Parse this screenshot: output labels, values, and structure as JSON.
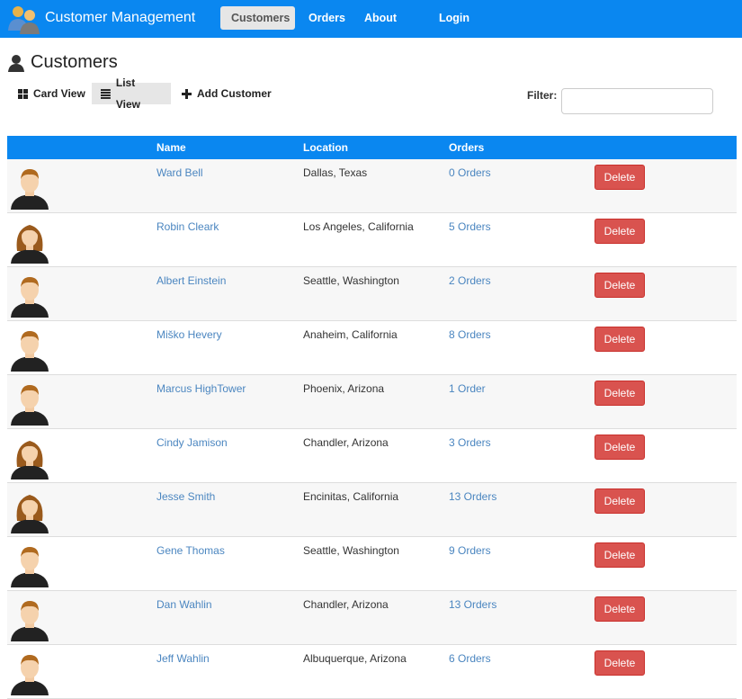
{
  "app": {
    "title": "Customer Management"
  },
  "nav": {
    "items": [
      {
        "label": "Customers",
        "active": true
      },
      {
        "label": "Orders"
      },
      {
        "label": "About"
      },
      {
        "label": "Login"
      }
    ]
  },
  "page": {
    "title": "Customers"
  },
  "toolbar": {
    "card_view": "Card View",
    "list_view": "List View",
    "add_customer": "Add Customer",
    "filter_label": "Filter:",
    "filter_value": ""
  },
  "table": {
    "headers": {
      "name": "Name",
      "location": "Location",
      "orders": "Orders"
    },
    "delete_label": "Delete",
    "rows": [
      {
        "name": "Ward Bell",
        "location": "Dallas, Texas",
        "orders": "0 Orders",
        "gender": "male"
      },
      {
        "name": "Robin Cleark",
        "location": "Los Angeles, California",
        "orders": "5 Orders",
        "gender": "female"
      },
      {
        "name": "Albert Einstein",
        "location": "Seattle, Washington",
        "orders": "2 Orders",
        "gender": "male"
      },
      {
        "name": "Miško Hevery",
        "location": "Anaheim, California",
        "orders": "8 Orders",
        "gender": "male"
      },
      {
        "name": "Marcus HighTower",
        "location": "Phoenix, Arizona",
        "orders": "1 Order",
        "gender": "male"
      },
      {
        "name": "Cindy Jamison",
        "location": "Chandler, Arizona",
        "orders": "3 Orders",
        "gender": "female"
      },
      {
        "name": "Jesse Smith",
        "location": "Encinitas, California",
        "orders": "13 Orders",
        "gender": "female"
      },
      {
        "name": "Gene Thomas",
        "location": "Seattle, Washington",
        "orders": "9 Orders",
        "gender": "male"
      },
      {
        "name": "Dan Wahlin",
        "location": "Chandler, Arizona",
        "orders": "13 Orders",
        "gender": "male"
      },
      {
        "name": "Jeff Wahlin",
        "location": "Albuquerque, Arizona",
        "orders": "6 Orders",
        "gender": "male"
      }
    ]
  },
  "colors": {
    "accent": "#0a87f0",
    "link": "#4b86c0",
    "danger": "#d9534f"
  }
}
